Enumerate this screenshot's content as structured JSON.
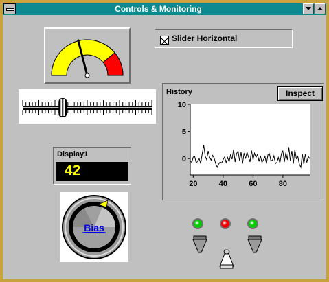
{
  "window": {
    "title": "Controls & Monitoring"
  },
  "gauge": {
    "value_fraction": 0.42,
    "zone_colors": {
      "low": "#ffff00",
      "high": "#ff0000",
      "bg": "#e0e0e0"
    }
  },
  "slider": {
    "value_fraction": 0.31
  },
  "checkbox": {
    "label": "Slider Horizontal",
    "checked": true
  },
  "display": {
    "title": "Display1",
    "value": "42",
    "value_color": "#ffff00"
  },
  "knob": {
    "label": "Bias"
  },
  "chart_data": {
    "type": "line",
    "title": "History",
    "xlim": [
      18,
      98
    ],
    "ylim": [
      -3,
      10
    ],
    "xticks": [
      20,
      40,
      60,
      80
    ],
    "yticks": [
      10,
      5,
      0
    ],
    "x": [
      18,
      19,
      20,
      21,
      22,
      23,
      24,
      25,
      26,
      27,
      28,
      29,
      30,
      31,
      32,
      33,
      34,
      35,
      36,
      37,
      38,
      39,
      40,
      41,
      42,
      43,
      44,
      45,
      46,
      47,
      48,
      49,
      50,
      51,
      52,
      53,
      54,
      55,
      56,
      57,
      58,
      59,
      60,
      61,
      62,
      63,
      64,
      65,
      66,
      67,
      68,
      69,
      70,
      71,
      72,
      73,
      74,
      75,
      76,
      77,
      78,
      79,
      80,
      81,
      82,
      83,
      84,
      85,
      86,
      87,
      88,
      89,
      90,
      91,
      92,
      93,
      94,
      95,
      96,
      97,
      98
    ],
    "values": [
      -0.4,
      -0.7,
      0.3,
      0.4,
      -0.8,
      -0.4,
      0.0,
      -0.9,
      0.9,
      2.5,
      0.4,
      -0.2,
      1.4,
      0.2,
      -0.3,
      0.6,
      0.1,
      -0.9,
      -1.6,
      -1.0,
      -0.6,
      -0.8,
      -0.2,
      0.3,
      -0.7,
      0.2,
      -0.6,
      0.7,
      -0.1,
      1.7,
      -0.6,
      0.9,
      1.4,
      -0.4,
      1.2,
      -0.9,
      1.0,
      0.0,
      1.2,
      0.3,
      -0.6,
      1.5,
      -0.2,
      1.0,
      0.2,
      0.8,
      -0.5,
      0.5,
      -0.7,
      -0.2,
      0.4,
      -0.9,
      0.7,
      0.9,
      -0.4,
      -0.3,
      0.5,
      -0.9,
      -0.7,
      0.2,
      -0.8,
      0.9,
      1.4,
      -0.6,
      1.1,
      -0.2,
      2.1,
      -0.4,
      1.4,
      -0.9,
      1.7,
      0.0,
      0.4,
      -1.0,
      -1.6,
      0.9,
      -1.0,
      0.8,
      -0.7,
      0.4,
      0.0
    ]
  },
  "inspect": {
    "label": "Inspect"
  },
  "leds": [
    {
      "color": "#00cc00"
    },
    {
      "color": "#ee0000"
    },
    {
      "color": "#00cc00"
    }
  ]
}
